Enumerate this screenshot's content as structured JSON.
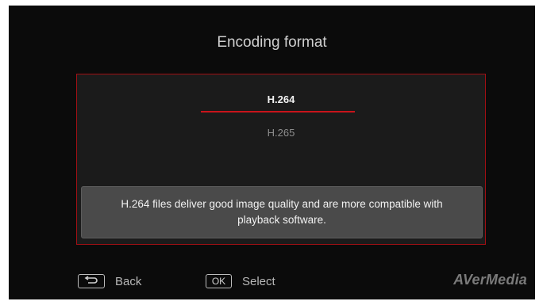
{
  "screen": {
    "title": "Encoding format"
  },
  "options": [
    {
      "label": "H.264",
      "selected": true
    },
    {
      "label": "H.265",
      "selected": false
    }
  ],
  "info_text": "H.264 files deliver good image quality and are more compatible with playback software.",
  "footer": {
    "back_key_icon": "return-arrow-icon",
    "back_label": "Back",
    "ok_key_label": "OK",
    "select_label": "Select",
    "brand": "AVerMedia"
  },
  "colors": {
    "accent": "#c9141b",
    "panel_bg": "#0b0b0b",
    "dialog_bg": "#1b1b1b",
    "info_bg": "#4a4a4a"
  }
}
